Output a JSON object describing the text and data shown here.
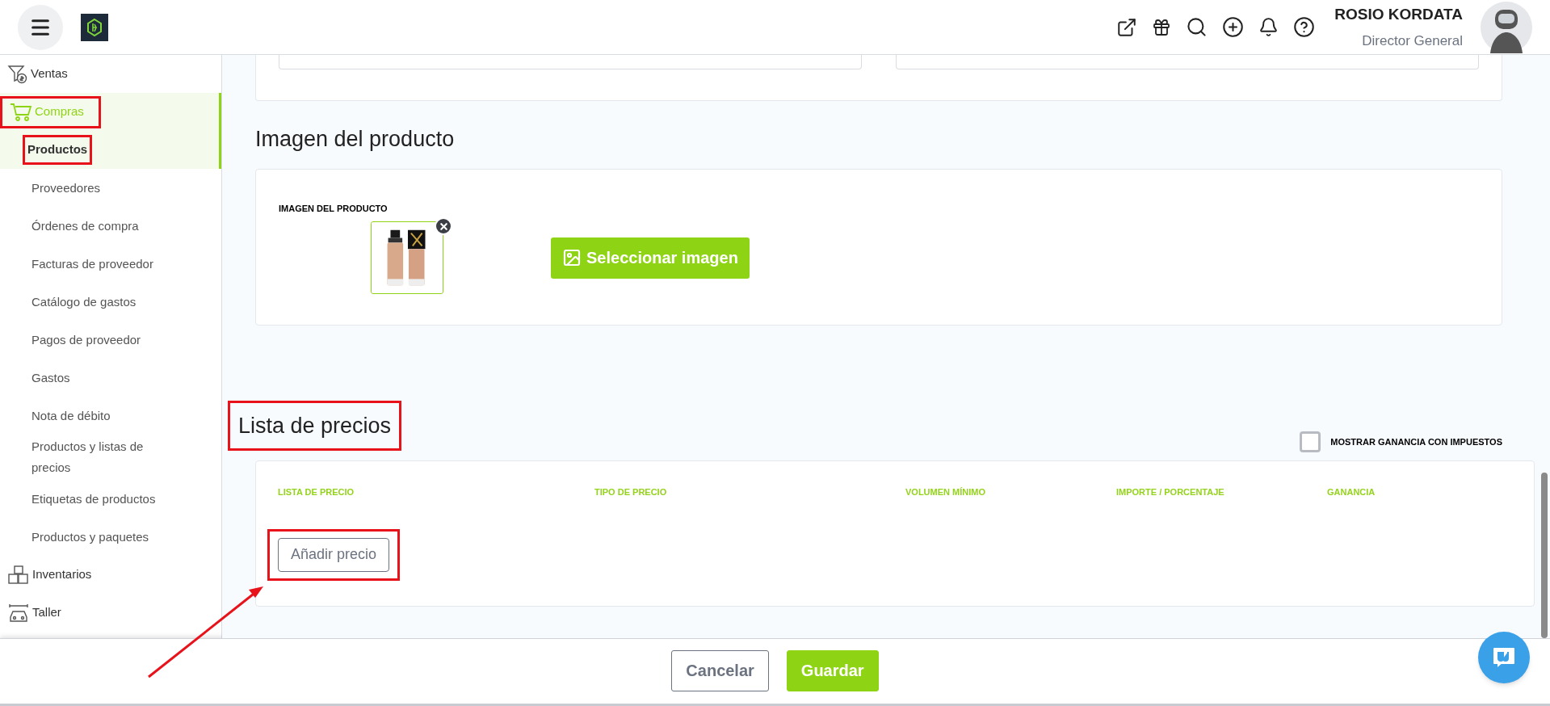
{
  "topbar": {
    "user_name": "ROSIO KORDATA",
    "user_role": "Director General"
  },
  "sidebar": {
    "sections": [
      {
        "label": "Ventas",
        "selected": false,
        "highlighted": false
      },
      {
        "label": "Compras",
        "selected": true,
        "highlighted": true,
        "children": [
          {
            "label": "Productos",
            "selected": true,
            "highlighted": true
          },
          {
            "label": "Proveedores",
            "selected": false,
            "highlighted": false
          },
          {
            "label": "Órdenes de compra",
            "selected": false,
            "highlighted": false
          },
          {
            "label": "Facturas de proveedor",
            "selected": false,
            "highlighted": false
          },
          {
            "label": "Catálogo de gastos",
            "selected": false,
            "highlighted": false
          },
          {
            "label": "Pagos de proveedor",
            "selected": false,
            "highlighted": false
          },
          {
            "label": "Gastos",
            "selected": false,
            "highlighted": false
          },
          {
            "label": "Nota de débito",
            "selected": false,
            "highlighted": false
          },
          {
            "label": "Productos y listas de precios",
            "selected": false,
            "highlighted": false
          },
          {
            "label": "Etiquetas de productos",
            "selected": false,
            "highlighted": false
          },
          {
            "label": "Productos y paquetes",
            "selected": false,
            "highlighted": false
          }
        ]
      },
      {
        "label": "Inventarios",
        "selected": false,
        "highlighted": false
      },
      {
        "label": "Taller",
        "selected": false,
        "highlighted": false
      }
    ]
  },
  "image_section": {
    "title": "Imagen del producto",
    "field_label": "IMAGEN DEL PRODUCTO",
    "select_button": "Seleccionar imagen"
  },
  "price_section": {
    "title": "Lista de precios",
    "highlighted": true,
    "tax_toggle": {
      "label": "MOSTRAR GANANCIA CON IMPUESTOS",
      "checked": false
    },
    "columns": [
      "LISTA DE PRECIO",
      "TIPO DE PRECIO",
      "VOLUMEN MÍNIMO",
      "IMPORTE / PORCENTAJE",
      "GANANCIA"
    ],
    "add_button": {
      "label": "Añadir precio",
      "highlighted": true
    }
  },
  "annotation_arrow": true,
  "footer": {
    "buttons": [
      {
        "label": "Cancelar",
        "kind": "secondary"
      },
      {
        "label": "Guardar",
        "kind": "primary"
      }
    ]
  }
}
